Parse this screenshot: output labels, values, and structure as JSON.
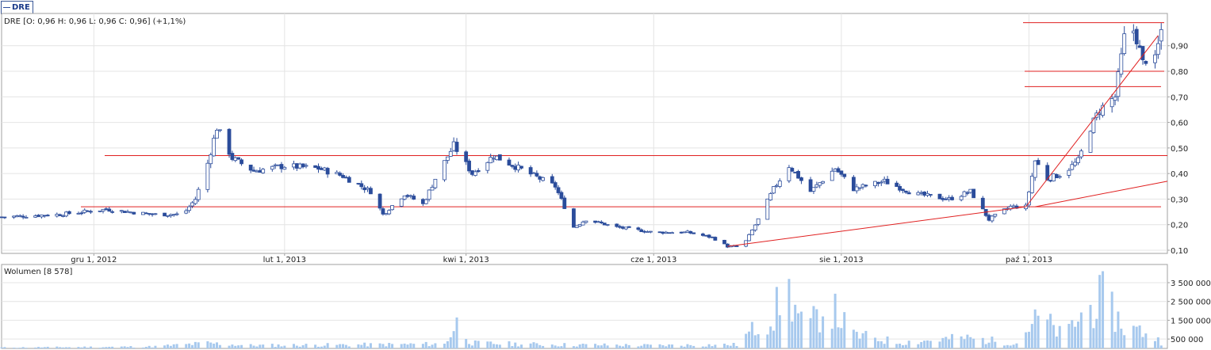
{
  "header": {
    "ticker": "DRE"
  },
  "price_panel": {
    "legend": "DRE [O: 0,96  H: 0,96  L: 0,96  C: 0,96] (+1,1%)"
  },
  "volume_panel": {
    "legend": "Wolumen [8 578]"
  },
  "colors": {
    "up": "#2b4c9b",
    "down": "#2b4c9b",
    "line": "#e02020",
    "volume": "#a7c9ee",
    "grid": "#e4e4e4",
    "frame": "#a0a0a0"
  },
  "chart_data": [
    {
      "type": "candlestick",
      "title": "",
      "ylim": [
        0.1,
        1.02
      ],
      "y_ticks": [
        "0,90",
        "0,80",
        "0,70",
        "0,60",
        "0,50",
        "0,40",
        "0,30",
        "0,20",
        "0,10"
      ],
      "x_ticks": [
        "gru 1, 2012",
        "lut 1, 2013",
        "kwi 1, 2013",
        "cze 1, 2013",
        "sie 1, 2013",
        "paź 1, 2013"
      ],
      "x_range": [
        "2012-11-01",
        "2013-11-15"
      ],
      "grid": true,
      "last": {
        "open": 0.96,
        "high": 0.96,
        "low": 0.96,
        "close": 0.96,
        "change_pct": 1.1
      },
      "horizontal_levels": [
        0.27,
        0.47,
        0.74,
        0.8,
        0.99
      ],
      "trend_lines": [
        {
          "from": [
            "2013-06-25",
            0.115
          ],
          "to": [
            "2013-09-30",
            0.27
          ]
        },
        {
          "from": [
            "2013-10-03",
            0.27
          ],
          "to": [
            "2013-11-15",
            0.37
          ]
        },
        {
          "from": [
            "2013-09-30",
            0.27
          ],
          "to": [
            "2013-11-12",
            0.94
          ]
        }
      ],
      "price_path": [
        [
          "2012-11-01",
          0.23
        ],
        [
          "2012-11-20",
          0.24
        ],
        [
          "2012-12-05",
          0.26
        ],
        [
          "2012-12-20",
          0.24
        ],
        [
          "2012-12-30",
          0.24
        ],
        [
          "2013-01-03",
          0.3
        ],
        [
          "2013-01-07",
          0.44
        ],
        [
          "2013-01-10",
          0.58
        ],
        [
          "2013-01-15",
          0.46
        ],
        [
          "2013-01-22",
          0.41
        ],
        [
          "2013-02-01",
          0.43
        ],
        [
          "2013-02-12",
          0.42
        ],
        [
          "2013-02-20",
          0.39
        ],
        [
          "2013-03-01",
          0.33
        ],
        [
          "2013-03-05",
          0.24
        ],
        [
          "2013-03-12",
          0.32
        ],
        [
          "2013-03-18",
          0.28
        ],
        [
          "2013-03-22",
          0.38
        ],
        [
          "2013-03-28",
          0.51
        ],
        [
          "2013-04-03",
          0.4
        ],
        [
          "2013-04-10",
          0.47
        ],
        [
          "2013-04-20",
          0.41
        ],
        [
          "2013-04-30",
          0.35
        ],
        [
          "2013-05-06",
          0.19
        ],
        [
          "2013-05-10",
          0.22
        ],
        [
          "2013-05-20",
          0.19
        ],
        [
          "2013-06-01",
          0.17
        ],
        [
          "2013-06-12",
          0.17
        ],
        [
          "2013-06-20",
          0.15
        ],
        [
          "2013-06-25",
          0.115
        ],
        [
          "2013-06-30",
          0.115
        ],
        [
          "2013-07-05",
          0.22
        ],
        [
          "2013-07-10",
          0.34
        ],
        [
          "2013-07-15",
          0.43
        ],
        [
          "2013-07-22",
          0.33
        ],
        [
          "2013-07-30",
          0.42
        ],
        [
          "2013-08-05",
          0.34
        ],
        [
          "2013-08-15",
          0.37
        ],
        [
          "2013-08-25",
          0.32
        ],
        [
          "2013-09-05",
          0.3
        ],
        [
          "2013-09-12",
          0.33
        ],
        [
          "2013-09-18",
          0.22
        ],
        [
          "2013-09-25",
          0.27
        ],
        [
          "2013-09-30",
          0.27
        ],
        [
          "2013-10-03",
          0.45
        ],
        [
          "2013-10-07",
          0.38
        ],
        [
          "2013-10-12",
          0.4
        ],
        [
          "2013-10-17",
          0.45
        ],
        [
          "2013-10-21",
          0.58
        ],
        [
          "2013-10-24",
          0.65
        ],
        [
          "2013-10-29",
          0.7
        ],
        [
          "2013-11-01",
          0.93
        ],
        [
          "2013-11-03",
          0.99
        ],
        [
          "2013-11-05",
          0.93
        ],
        [
          "2013-11-07",
          0.83
        ],
        [
          "2013-11-09",
          0.87
        ],
        [
          "2013-11-11",
          0.84
        ],
        [
          "2013-11-13",
          0.96
        ]
      ]
    },
    {
      "type": "bar",
      "title": "",
      "ylim": [
        0,
        4300000
      ],
      "y_ticks": [
        "3 500 000",
        "2 500 000",
        "1 500 000",
        "500 000"
      ],
      "y_tick_values": [
        3500000,
        2500000,
        1500000,
        500000
      ],
      "grid": true,
      "volume_path": [
        [
          "2012-11-01",
          60000
        ],
        [
          "2012-12-20",
          120000
        ],
        [
          "2013-01-07",
          350000
        ],
        [
          "2013-01-20",
          200000
        ],
        [
          "2013-03-01",
          250000
        ],
        [
          "2013-03-25",
          300000
        ],
        [
          "2013-03-29",
          1650000
        ],
        [
          "2013-04-03",
          350000
        ],
        [
          "2013-05-01",
          250000
        ],
        [
          "2013-06-01",
          200000
        ],
        [
          "2013-06-28",
          250000
        ],
        [
          "2013-07-03",
          1200000
        ],
        [
          "2013-07-10",
          2200000
        ],
        [
          "2013-07-14",
          4100000
        ],
        [
          "2013-07-20",
          1200000
        ],
        [
          "2013-07-28",
          2900000
        ],
        [
          "2013-08-05",
          900000
        ],
        [
          "2013-08-20",
          400000
        ],
        [
          "2013-09-10",
          700000
        ],
        [
          "2013-09-27",
          350000
        ],
        [
          "2013-10-01",
          1500000
        ],
        [
          "2013-10-05",
          2100000
        ],
        [
          "2013-10-12",
          800000
        ],
        [
          "2013-10-19",
          2400000
        ],
        [
          "2013-10-25",
          3300000
        ],
        [
          "2013-11-01",
          1400000
        ],
        [
          "2013-11-08",
          1100000
        ],
        [
          "2013-11-14",
          300000
        ]
      ]
    }
  ]
}
